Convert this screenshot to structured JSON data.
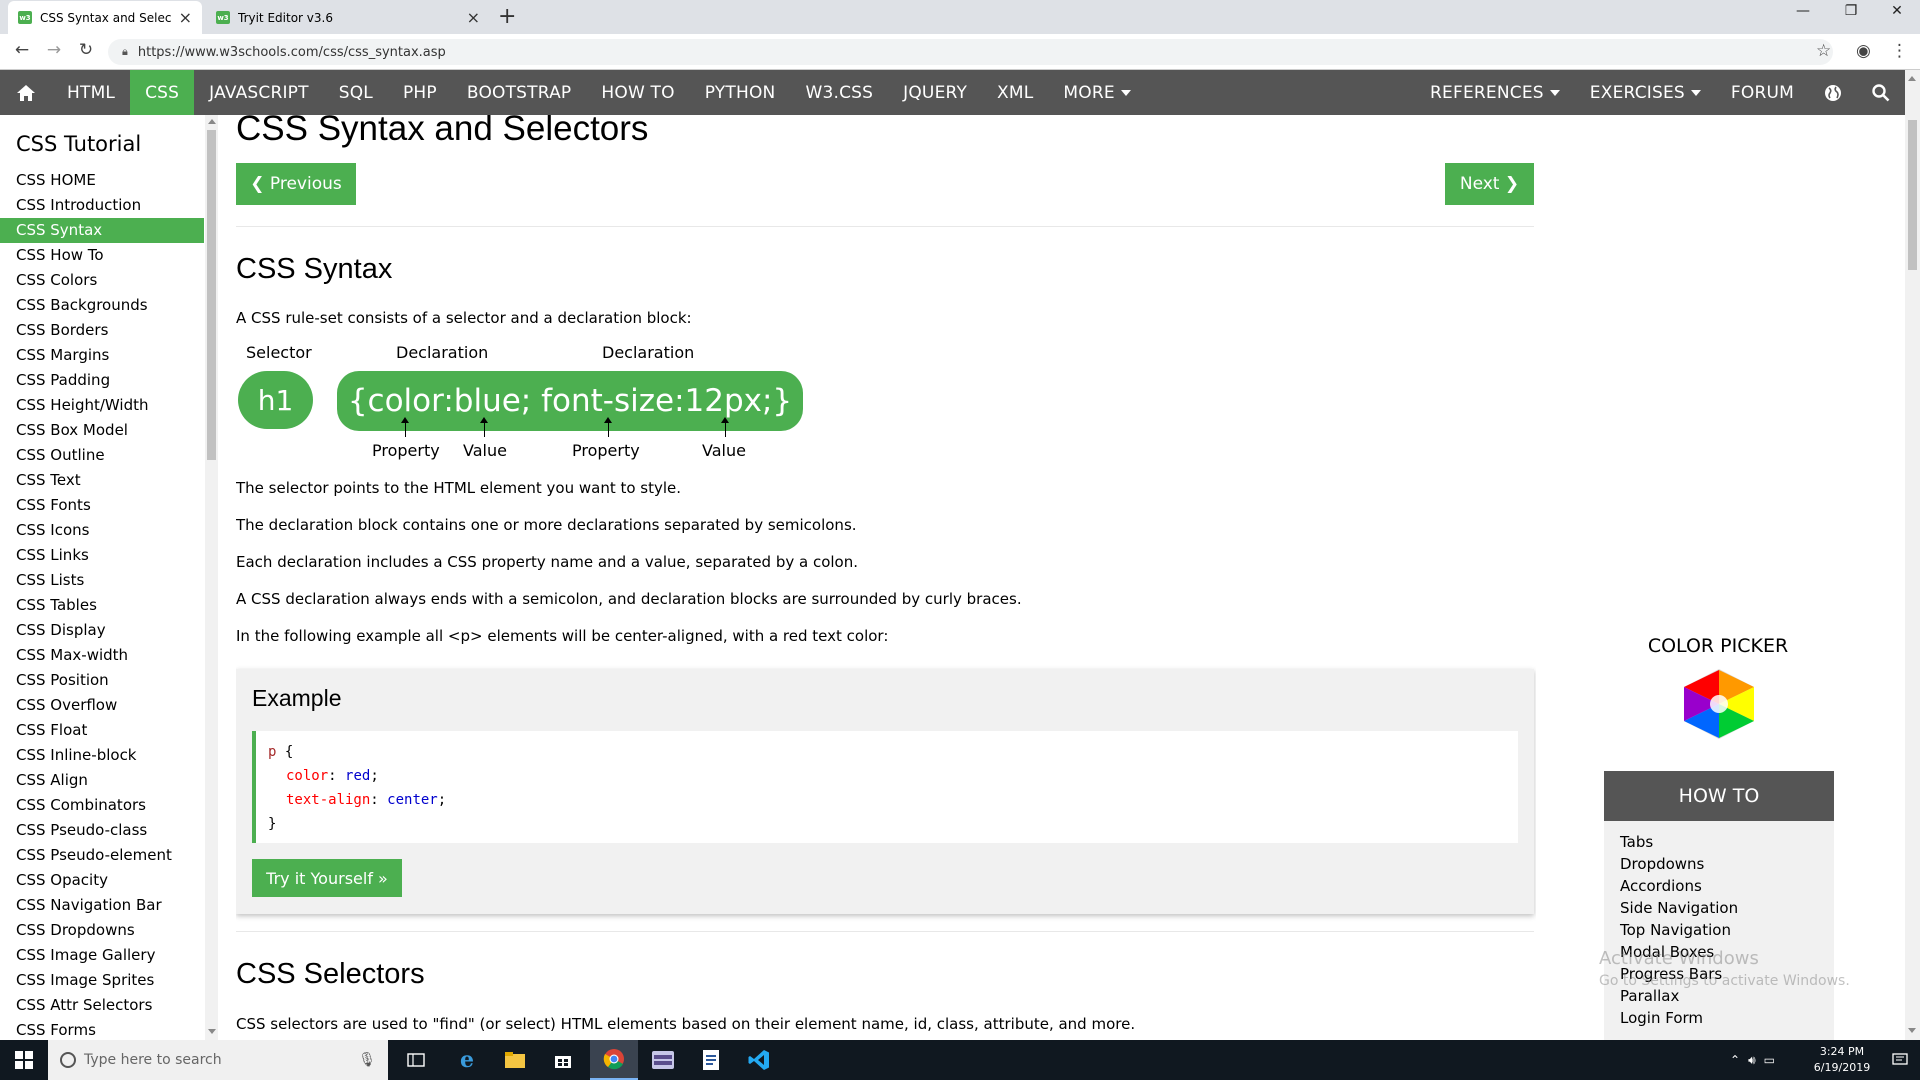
{
  "browser": {
    "tabs": [
      {
        "title": "CSS Syntax and Selectors",
        "favicon": "w3"
      },
      {
        "title": "Tryit Editor v3.6",
        "favicon": "w3"
      }
    ],
    "url": "https://www.w3schools.com/css/css_syntax.asp"
  },
  "topnav": {
    "items": [
      "HTML",
      "CSS",
      "JAVASCRIPT",
      "SQL",
      "PHP",
      "BOOTSTRAP",
      "HOW TO",
      "PYTHON",
      "W3.CSS",
      "JQUERY",
      "XML",
      "MORE"
    ],
    "active": "CSS",
    "right_items": [
      "REFERENCES",
      "EXERCISES",
      "FORUM"
    ]
  },
  "sidebar": {
    "title": "CSS Tutorial",
    "items": [
      "CSS HOME",
      "CSS Introduction",
      "CSS Syntax",
      "CSS How To",
      "CSS Colors",
      "CSS Backgrounds",
      "CSS Borders",
      "CSS Margins",
      "CSS Padding",
      "CSS Height/Width",
      "CSS Box Model",
      "CSS Outline",
      "CSS Text",
      "CSS Fonts",
      "CSS Icons",
      "CSS Links",
      "CSS Lists",
      "CSS Tables",
      "CSS Display",
      "CSS Max-width",
      "CSS Position",
      "CSS Overflow",
      "CSS Float",
      "CSS Inline-block",
      "CSS Align",
      "CSS Combinators",
      "CSS Pseudo-class",
      "CSS Pseudo-element",
      "CSS Opacity",
      "CSS Navigation Bar",
      "CSS Dropdowns",
      "CSS Image Gallery",
      "CSS Image Sprites",
      "CSS Attr Selectors",
      "CSS Forms"
    ],
    "active": "CSS Syntax"
  },
  "main": {
    "title": "CSS Syntax and Selectors",
    "prev_label": "❮ Previous",
    "next_label": "Next ❯",
    "syntax_heading": "CSS Syntax",
    "intro": "A CSS rule-set consists of a selector and a declaration block:",
    "diagram": {
      "selector_label": "Selector",
      "declaration_label": "Declaration",
      "selector": "h1",
      "declaration": "{color:blue; font-size:12px;}",
      "property_label": "Property",
      "value_label": "Value"
    },
    "paragraphs": [
      "The selector points to the HTML element you want to style.",
      "The declaration block contains one or more declarations separated by semicolons.",
      "Each declaration includes a CSS property name and a value, separated by a colon.",
      "A CSS declaration always ends with a semicolon, and declaration blocks are surrounded by curly braces.",
      "In the following example all <p> elements will be center-aligned, with a red text color:"
    ],
    "example": {
      "title": "Example",
      "code": {
        "selector": "p",
        "open": " {",
        "lines": [
          {
            "prop": "color",
            "value": "red"
          },
          {
            "prop": "text-align",
            "value": "center"
          }
        ],
        "close": "}"
      },
      "try_label": "Try it Yourself »"
    },
    "selectors_heading": "CSS Selectors",
    "selectors_intro": "CSS selectors are used to \"find\" (or select) HTML elements based on their element name, id, class, attribute, and more."
  },
  "right": {
    "color_picker_title": "COLOR PICKER",
    "howto_title": "HOW TO",
    "howto_items": [
      "Tabs",
      "Dropdowns",
      "Accordions",
      "Side Navigation",
      "Top Navigation",
      "Modal Boxes",
      "Progress Bars",
      "Parallax",
      "Login Form"
    ]
  },
  "watermark": {
    "line1": "Activate Windows",
    "line2": "Go to Settings to activate Windows."
  },
  "taskbar": {
    "search_placeholder": "Type here to search",
    "time": "3:24 PM",
    "date": "6/19/2019"
  },
  "colors": {
    "brand_green": "#4CAF50",
    "nav_gray": "#555555"
  }
}
